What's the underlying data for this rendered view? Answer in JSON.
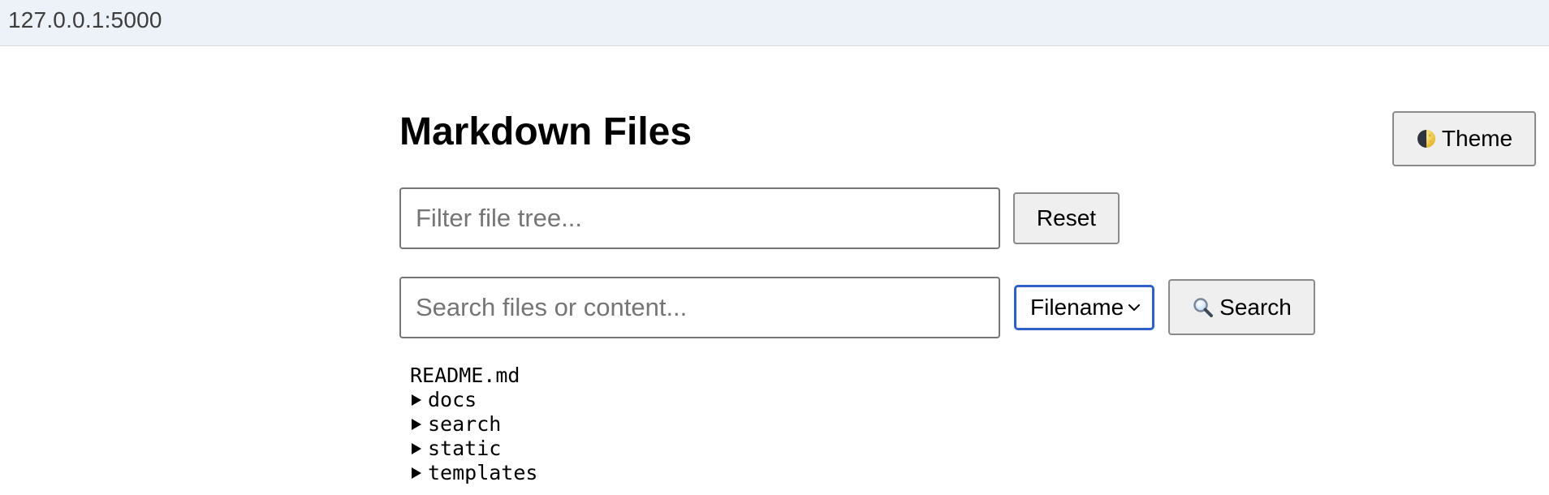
{
  "browser": {
    "url": "127.0.0.1:5000"
  },
  "header": {
    "title": "Markdown Files",
    "theme_button_label": "Theme",
    "theme_icon": "moon-icon"
  },
  "filter": {
    "placeholder": "Filter file tree...",
    "value": "",
    "reset_label": "Reset"
  },
  "search": {
    "placeholder": "Search files or content...",
    "value": "",
    "mode_selected": "Filename",
    "button_label": "Search",
    "button_icon": "search-icon"
  },
  "file_tree": {
    "items": [
      {
        "label": "README.md",
        "type": "file"
      },
      {
        "label": "docs",
        "type": "folder",
        "expanded": false
      },
      {
        "label": "search",
        "type": "folder",
        "expanded": false
      },
      {
        "label": "static",
        "type": "folder",
        "expanded": false
      },
      {
        "label": "templates",
        "type": "folder",
        "expanded": false
      }
    ]
  },
  "colors": {
    "address_bar_bg": "#edf1f8",
    "select_focus_border": "#2f60c9",
    "button_bg": "#efefef"
  }
}
